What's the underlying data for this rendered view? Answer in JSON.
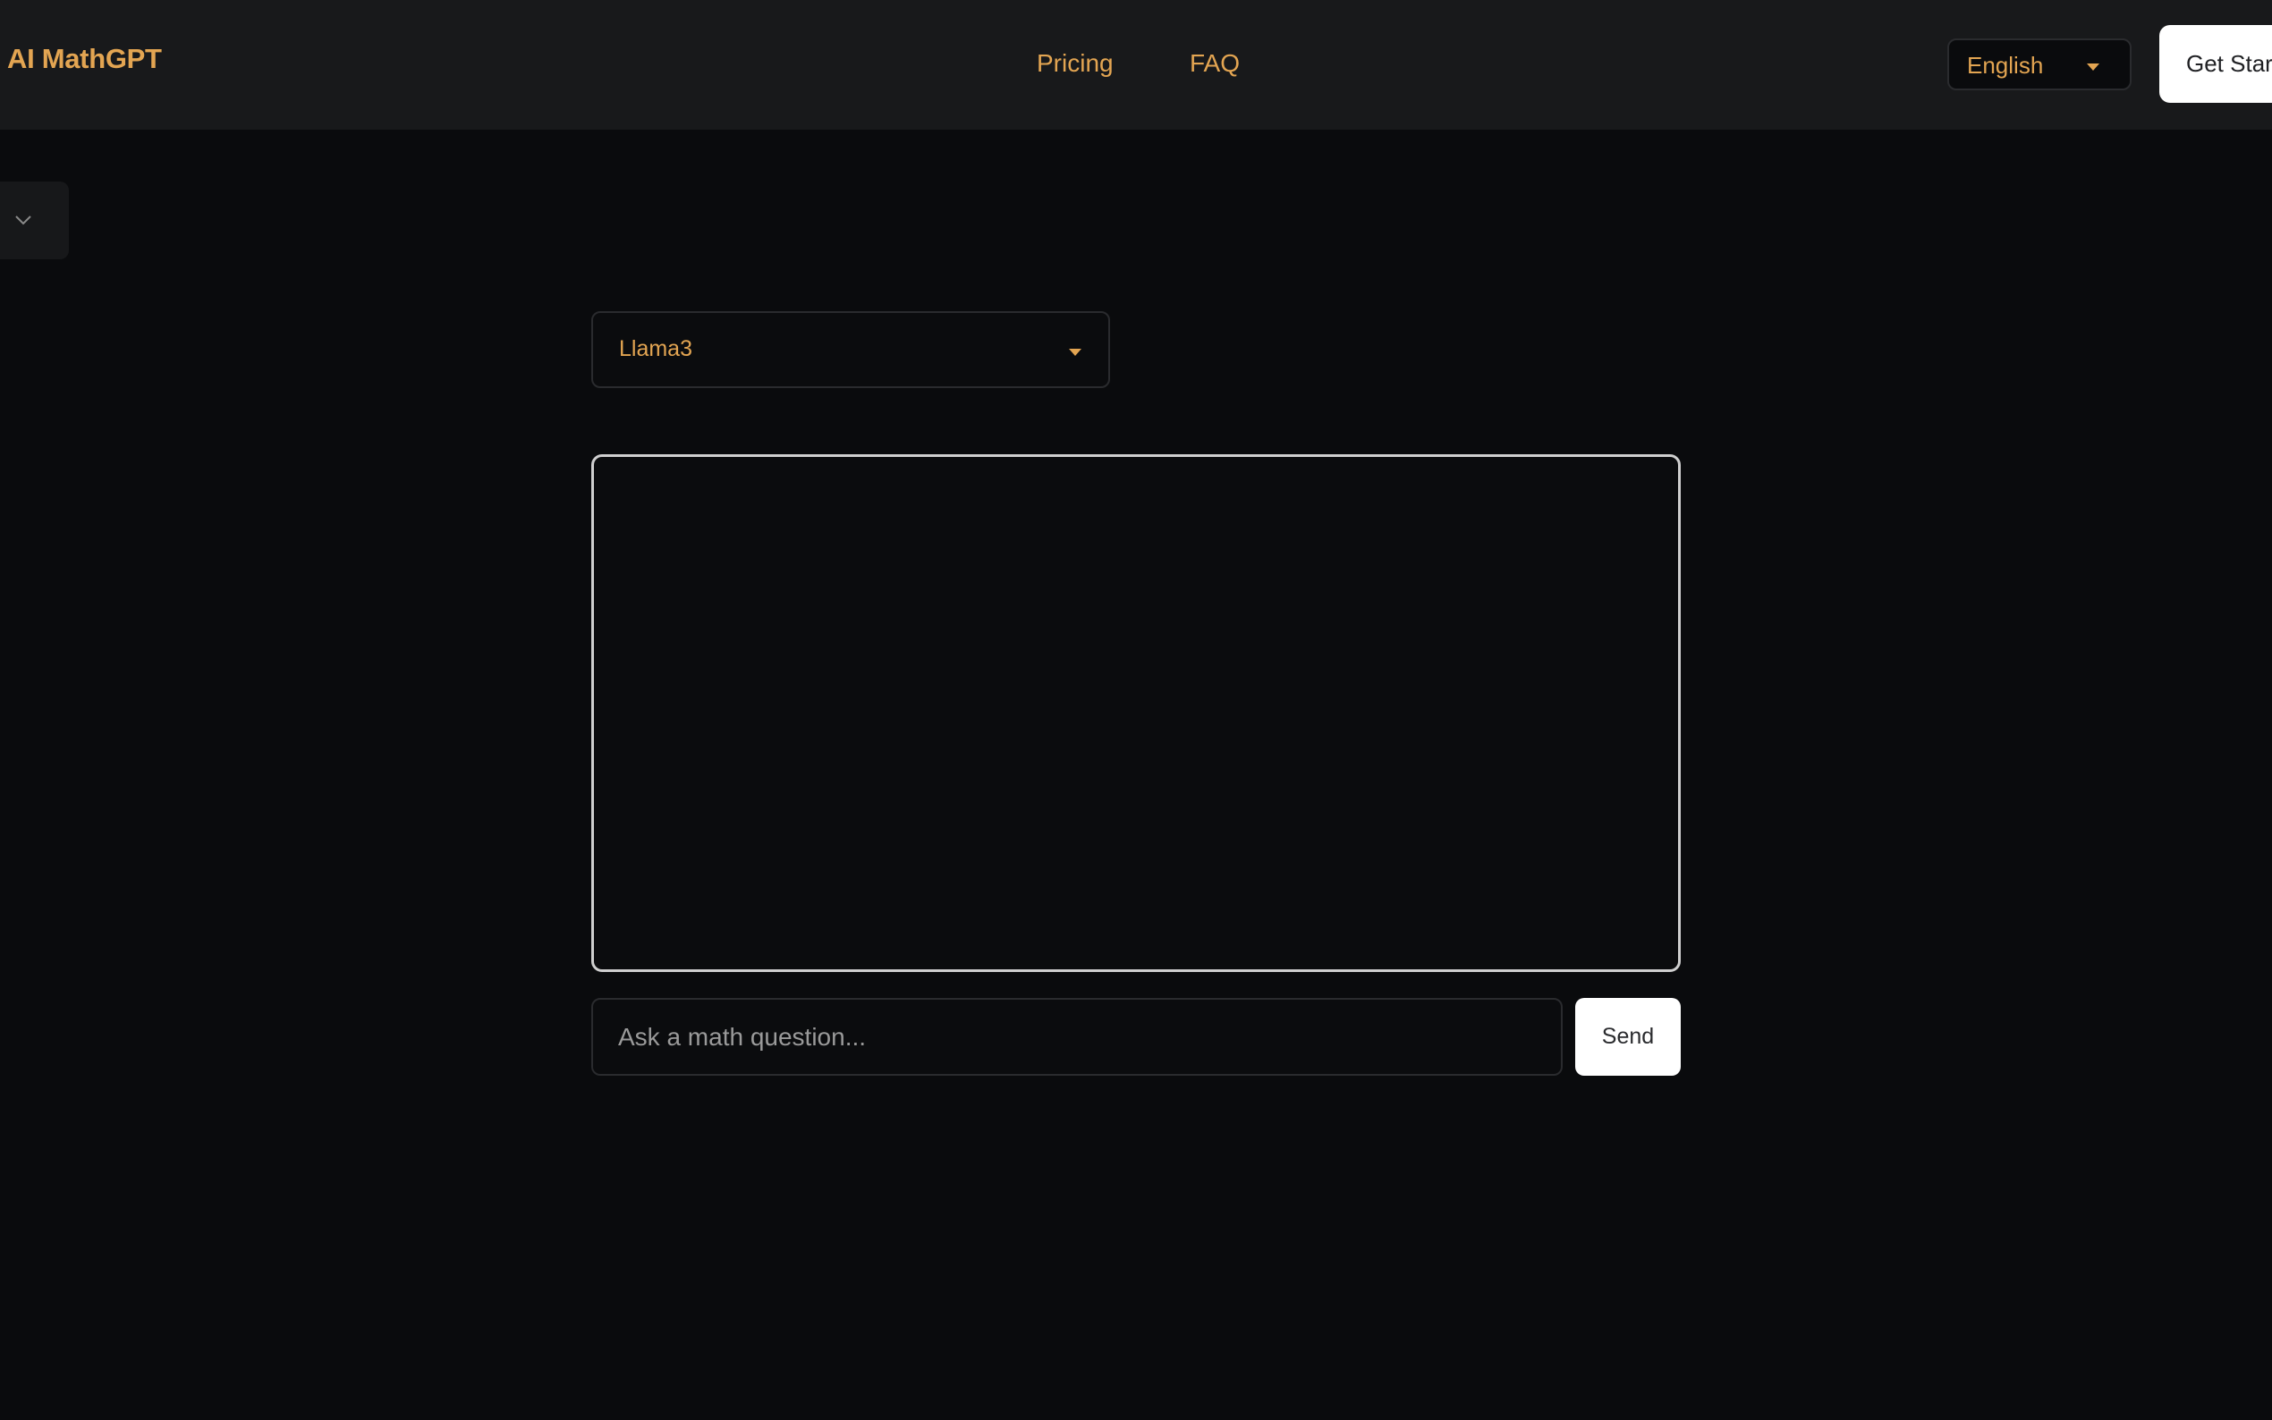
{
  "header": {
    "brand": "AI MathGPT",
    "nav": [
      {
        "label": "Pricing"
      },
      {
        "label": "FAQ"
      }
    ],
    "language": {
      "selected": "English"
    },
    "cta_label": "Get Started"
  },
  "sidebar": {
    "toggle_icon": "chevron-down-icon"
  },
  "model_select": {
    "selected": "Llama3"
  },
  "chat": {
    "input_placeholder": "Ask a math question...",
    "input_value": "",
    "send_label": "Send"
  },
  "colors": {
    "accent": "#e3a552",
    "background": "#0a0b0d",
    "header_bg": "#18191b",
    "button_bg": "#ffffff"
  }
}
